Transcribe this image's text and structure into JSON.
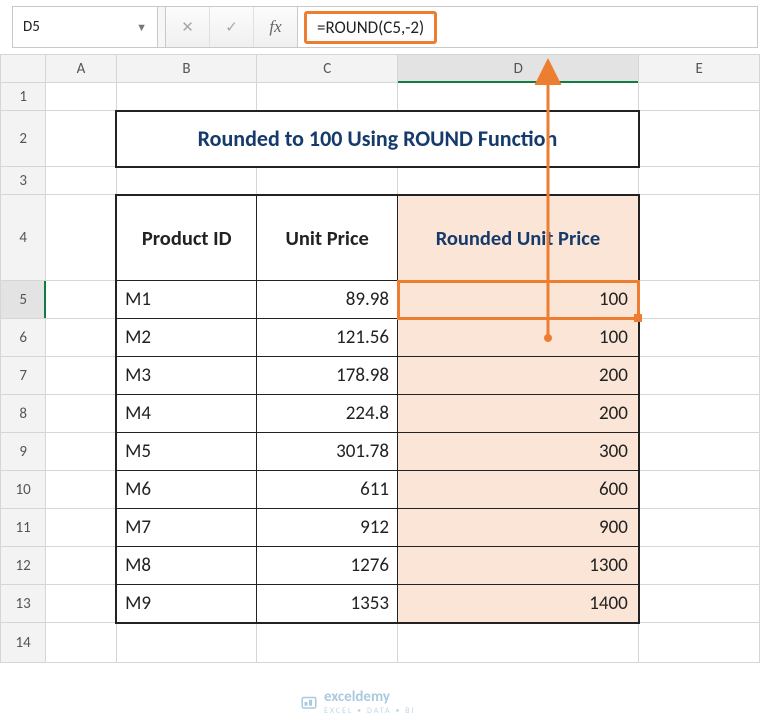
{
  "formula_bar": {
    "name_box": "D5",
    "cancel_icon": "✕",
    "confirm_icon": "✓",
    "fx_label": "fx",
    "formula": "=ROUND(C5,-2)"
  },
  "columns": {
    "sel": "",
    "A": "A",
    "B": "B",
    "C": "C",
    "D": "D",
    "E": "E"
  },
  "rows": [
    "1",
    "2",
    "3",
    "4",
    "5",
    "6",
    "7",
    "8",
    "9",
    "10",
    "11",
    "12",
    "13",
    "14"
  ],
  "title": "Rounded to  100 Using ROUND Function",
  "headers": {
    "product_id": "Product ID",
    "unit_price": "Unit Price",
    "rounded": "Rounded Unit Price"
  },
  "chart_data": {
    "type": "table",
    "title": "Rounded to 100 Using ROUND Function",
    "columns": [
      "Product ID",
      "Unit Price",
      "Rounded Unit Price"
    ],
    "rows": [
      {
        "id": "M1",
        "price": "89.98",
        "rounded": "100"
      },
      {
        "id": "M2",
        "price": "121.56",
        "rounded": "100"
      },
      {
        "id": "M3",
        "price": "178.98",
        "rounded": "200"
      },
      {
        "id": "M4",
        "price": "224.8",
        "rounded": "200"
      },
      {
        "id": "M5",
        "price": "301.78",
        "rounded": "300"
      },
      {
        "id": "M6",
        "price": "611",
        "rounded": "600"
      },
      {
        "id": "M7",
        "price": "912",
        "rounded": "900"
      },
      {
        "id": "M8",
        "price": "1276",
        "rounded": "1300"
      },
      {
        "id": "M9",
        "price": "1353",
        "rounded": "1400"
      }
    ]
  },
  "watermark": {
    "brand": "exceldemy",
    "tag": "EXCEL • DATA • BI"
  }
}
